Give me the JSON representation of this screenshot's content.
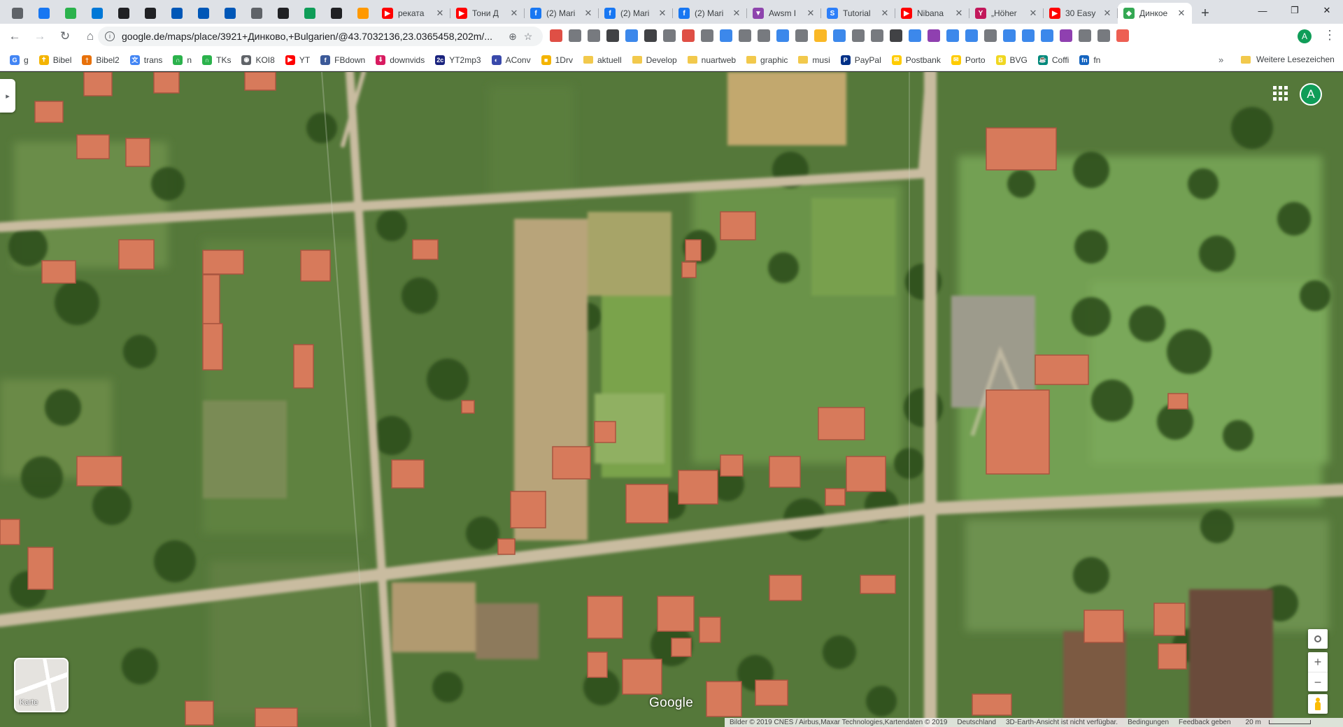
{
  "browser": {
    "tabs": [
      {
        "label": "рекатa",
        "icon_name": "youtube-icon",
        "icon_color": "#ff0000",
        "icon_glyph": "▶"
      },
      {
        "label": "Тони Д",
        "icon_name": "youtube-icon",
        "icon_color": "#ff0000",
        "icon_glyph": "▶"
      },
      {
        "label": "(2) Mari",
        "icon_name": "facebook-icon",
        "icon_color": "#1877f2",
        "icon_glyph": "f"
      },
      {
        "label": "(2) Mari",
        "icon_name": "facebook-icon",
        "icon_color": "#1877f2",
        "icon_glyph": "f"
      },
      {
        "label": "(2) Mari",
        "icon_name": "facebook-icon",
        "icon_color": "#1877f2",
        "icon_glyph": "f"
      },
      {
        "label": "Awsm I",
        "icon_name": "awesome-icon",
        "icon_color": "#8e44ad",
        "icon_glyph": "▼"
      },
      {
        "label": "Tutorial",
        "icon_name": "tutorial-icon",
        "icon_color": "#2d7ff9",
        "icon_glyph": "S"
      },
      {
        "label": "Nibana",
        "icon_name": "youtube-icon",
        "icon_color": "#ff0000",
        "icon_glyph": "▶"
      },
      {
        "label": "„Höher",
        "icon_name": "yahoo-icon",
        "icon_color": "#c2185b",
        "icon_glyph": "Y"
      },
      {
        "label": "30 Easy",
        "icon_name": "youtube-icon",
        "icon_color": "#ff0000",
        "icon_glyph": "▶"
      },
      {
        "label": "Динкое",
        "icon_name": "google-maps-icon",
        "icon_color": "#34a853",
        "icon_glyph": "◆"
      }
    ],
    "active_tab_index": 10,
    "pinned_tabs": [
      {
        "icon_name": "reader-icon",
        "color": "#5f6368"
      },
      {
        "icon_name": "facebook-icon",
        "color": "#1877f2"
      },
      {
        "icon_name": "feedly-icon",
        "color": "#2bb24c"
      },
      {
        "icon_name": "windows-icon",
        "color": "#0078d7"
      },
      {
        "icon_name": "bowtie-icon",
        "color": "#202124"
      },
      {
        "icon_name": "gear-icon",
        "color": "#202124"
      },
      {
        "icon_name": "ukraine-flag-icon",
        "color": "#0057b7"
      },
      {
        "icon_name": "ukraine-flag-icon",
        "color": "#0057b7"
      },
      {
        "icon_name": "ukraine-flag-icon",
        "color": "#0057b7"
      },
      {
        "icon_name": "world-icon",
        "color": "#5f6368"
      },
      {
        "icon_name": "gear-icon",
        "color": "#202124"
      },
      {
        "icon_name": "spreadsheet-icon",
        "color": "#0f9d58"
      },
      {
        "icon_name": "gear-icon",
        "color": "#202124"
      },
      {
        "icon_name": "amazon-icon",
        "color": "#ff9900"
      }
    ],
    "new_tab_label": "+",
    "window_controls": {
      "minimize": "—",
      "maximize": "❐",
      "close": "✕"
    },
    "nav": {
      "back": "←",
      "forward": "→",
      "reload": "↻",
      "home": "⌂"
    },
    "url": "google.de/maps/place/3921+Динково,+Bulgarien/@43.7032136,23.0365458,202m/...",
    "url_info_glyph": "i",
    "omnibox_actions": {
      "lens": "⊕",
      "star": "☆"
    },
    "extensions": [
      "#d93025",
      "#5f6368",
      "#5f6368",
      "#202124",
      "#1a73e8",
      "#202124",
      "#5f6368",
      "#d93025",
      "#5f6368",
      "#1a73e8",
      "#5f6368",
      "#5f6368",
      "#1a73e8",
      "#5f6368",
      "#f9ab00",
      "#1a73e8",
      "#5f6368",
      "#5f6368",
      "#202124",
      "#1a73e8",
      "#7b1fa2",
      "#1a73e8",
      "#1a73e8",
      "#5f6368",
      "#1a73e8",
      "#1a73e8",
      "#1a73e8",
      "#7b1fa2",
      "#5f6368",
      "#5f6368",
      "#ea4335"
    ],
    "profile_initial": "A",
    "menu_glyph": "⋮",
    "bookmarks": [
      {
        "label": "g",
        "color": "#4285f4",
        "glyph": "G"
      },
      {
        "label": "Bibel",
        "color": "#f4b400",
        "glyph": "✝"
      },
      {
        "label": "Bibel2",
        "color": "#e8710a",
        "glyph": "†"
      },
      {
        "label": "trans",
        "color": "#4285f4",
        "glyph": "文"
      },
      {
        "label": "n",
        "color": "#2bb24c",
        "glyph": "∩"
      },
      {
        "label": "TKs",
        "color": "#2bb24c",
        "glyph": "∩"
      },
      {
        "label": "KOI8",
        "color": "#5f6368",
        "glyph": "◉"
      },
      {
        "label": "YT",
        "color": "#ff0000",
        "glyph": "▶"
      },
      {
        "label": "FBdown",
        "color": "#3b5998",
        "glyph": "f"
      },
      {
        "label": "downvids",
        "color": "#d81b60",
        "glyph": "⇓"
      },
      {
        "label": "YT2mp3",
        "color": "#1a237e",
        "glyph": "2c"
      },
      {
        "label": "AConv",
        "color": "#3949ab",
        "glyph": "◐"
      },
      {
        "label": "1Drv",
        "color": "#f4b400",
        "glyph": "■"
      },
      {
        "label": "aktuell",
        "folder": true
      },
      {
        "label": "Develop",
        "folder": true
      },
      {
        "label": "nuartweb",
        "folder": true
      },
      {
        "label": "graphic",
        "folder": true
      },
      {
        "label": "musi",
        "folder": true
      },
      {
        "label": "PayPal",
        "color": "#003087",
        "glyph": "P"
      },
      {
        "label": "Postbank",
        "color": "#ffcc00",
        "glyph": "✉"
      },
      {
        "label": "Porto",
        "color": "#ffcc00",
        "glyph": "✉"
      },
      {
        "label": "BVG",
        "color": "#f0d722",
        "glyph": "B"
      },
      {
        "label": "Coffi",
        "color": "#00897b",
        "glyph": "☕"
      },
      {
        "label": "fn",
        "color": "#1565c0",
        "glyph": "fn"
      }
    ],
    "bookmarks_overflow": "»",
    "other_bookmarks": "Weitere Lesezeichen"
  },
  "map": {
    "collapse_glyph": "▸",
    "apps_icon": "apps-grid-icon",
    "account_initial": "A",
    "layer_switch_label": "Karte",
    "zoom_in": "+",
    "zoom_out": "−",
    "logo": "Google",
    "footer": {
      "imagery": "Bilder © 2019 CNES / Airbus,Maxar Technologies,Kartendaten © 2019",
      "region": "Deutschland",
      "earth_notice": "3D-Earth-Ansicht ist nicht verfügbar.",
      "terms": "Bedingungen",
      "feedback": "Feedback geben",
      "scale": "20 m"
    }
  }
}
